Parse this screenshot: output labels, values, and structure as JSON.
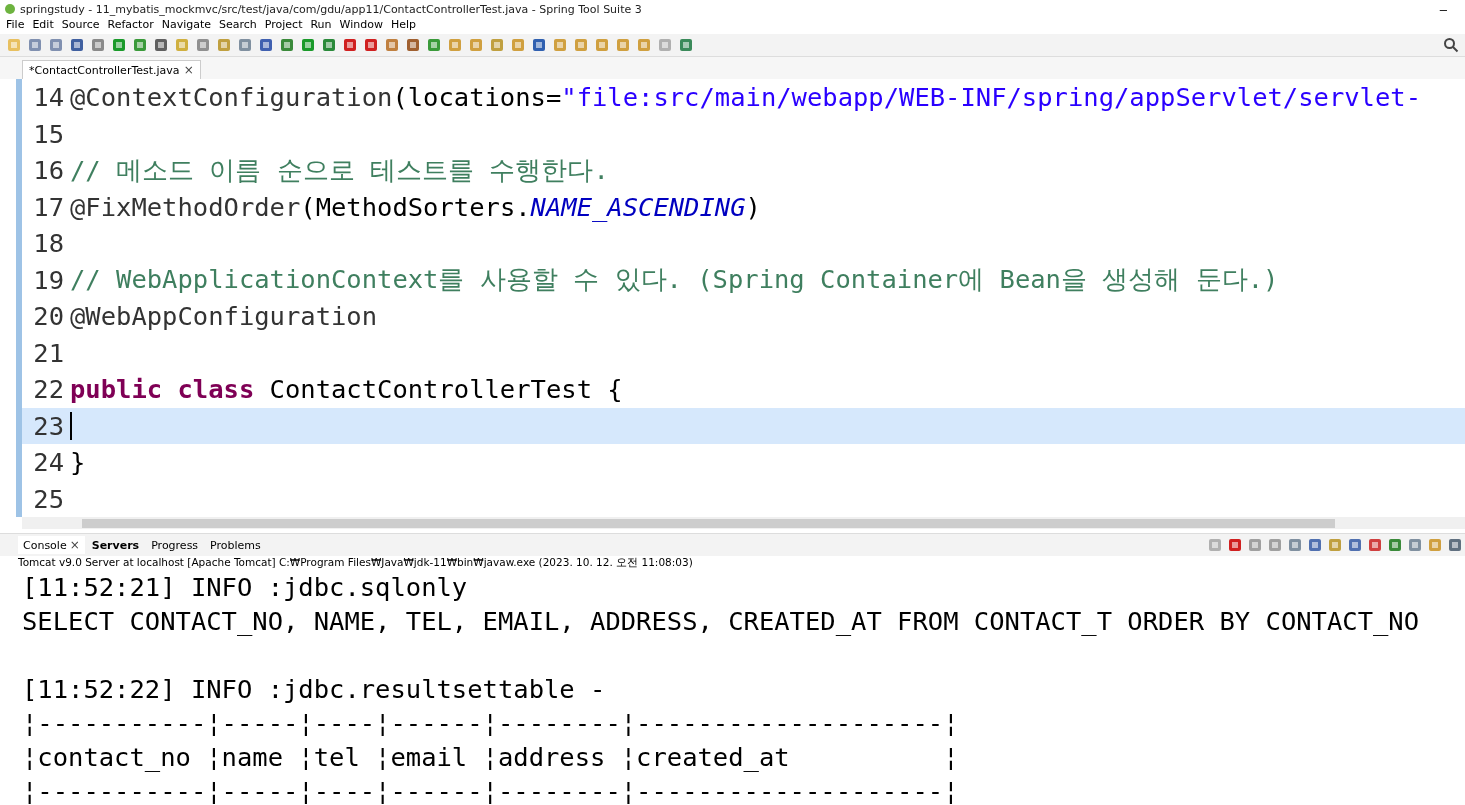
{
  "window": {
    "title": "springstudy - 11_mybatis_mockmvc/src/test/java/com/gdu/app11/ContactControllerTest.java - Spring Tool Suite 3",
    "minimize": "–"
  },
  "menu": [
    "File",
    "Edit",
    "Source",
    "Refactor",
    "Navigate",
    "Search",
    "Project",
    "Run",
    "Window",
    "Help"
  ],
  "editor_tabs": [
    {
      "label": "*ContactControllerTest.java",
      "close": "×",
      "selected": true
    }
  ],
  "editor": {
    "lines": [
      {
        "number": "14",
        "current": false,
        "tokens": [
          {
            "kind": "annotation",
            "text": "@ContextConfiguration"
          },
          {
            "kind": "plain",
            "text": "(locations="
          },
          {
            "kind": "string",
            "text": "\"file:src/main/webapp/WEB-INF/spring/appServlet/servlet-"
          }
        ]
      },
      {
        "number": "15",
        "current": false
      },
      {
        "number": "16",
        "current": false,
        "tokens": [
          {
            "kind": "comment",
            "text": "// 메소드 이름 순으로 테스트를 수행한다."
          }
        ]
      },
      {
        "number": "17",
        "current": false,
        "tokens": [
          {
            "kind": "annotation",
            "text": "@FixMethodOrder"
          },
          {
            "kind": "plain",
            "text": "(MethodSorters."
          },
          {
            "kind": "constant",
            "text": "NAME_ASCENDING"
          },
          {
            "kind": "plain",
            "text": ")"
          }
        ]
      },
      {
        "number": "18",
        "current": false
      },
      {
        "number": "19",
        "current": false,
        "tokens": [
          {
            "kind": "comment",
            "text": "// WebApplicationContext를 사용할 수 있다. (Spring Container에 Bean을 생성해 둔다.)"
          }
        ]
      },
      {
        "number": "20",
        "current": false,
        "tokens": [
          {
            "kind": "annotation",
            "text": "@WebAppConfiguration"
          }
        ]
      },
      {
        "number": "21",
        "current": false
      },
      {
        "number": "22",
        "current": false,
        "tokens": [
          {
            "kind": "keyword",
            "text": "public class"
          },
          {
            "kind": "plain",
            "text": " ContactControllerTest {"
          }
        ]
      },
      {
        "number": "23",
        "current": true
      },
      {
        "number": "24",
        "current": false,
        "tokens": [
          {
            "kind": "plain",
            "text": "}"
          }
        ]
      },
      {
        "number": "25",
        "current": false
      }
    ]
  },
  "console_tabs": [
    {
      "label": "Console",
      "close": "×",
      "selected": true,
      "bold": false
    },
    {
      "label": "Servers",
      "selected": false,
      "bold": true
    },
    {
      "label": "Progress",
      "selected": false,
      "bold": false
    },
    {
      "label": "Problems",
      "selected": false,
      "bold": false
    }
  ],
  "console": {
    "description": "Tomcat v9.0 Server at localhost [Apache Tomcat] C:₩Program Files₩Java₩jdk-11₩bin₩javaw.exe  (2023. 10. 12. 오전 11:08:03)",
    "blocks": [
      {
        "lines": [
          "[11:52:21] INFO :jdbc.sqlonly",
          "SELECT CONTACT_NO, NAME, TEL, EMAIL, ADDRESS, CREATED_AT FROM CONTACT_T ORDER BY CONTACT_NO"
        ]
      },
      {
        "lines": [
          "[11:52:22] INFO :jdbc.resultsettable -",
          "¦-----------¦-----¦----¦------¦--------¦--------------------¦",
          "¦contact_no ¦name ¦tel ¦email ¦address ¦created_at          ¦",
          "¦-----------¦-----¦----¦------¦--------¦--------------------¦"
        ]
      }
    ]
  }
}
